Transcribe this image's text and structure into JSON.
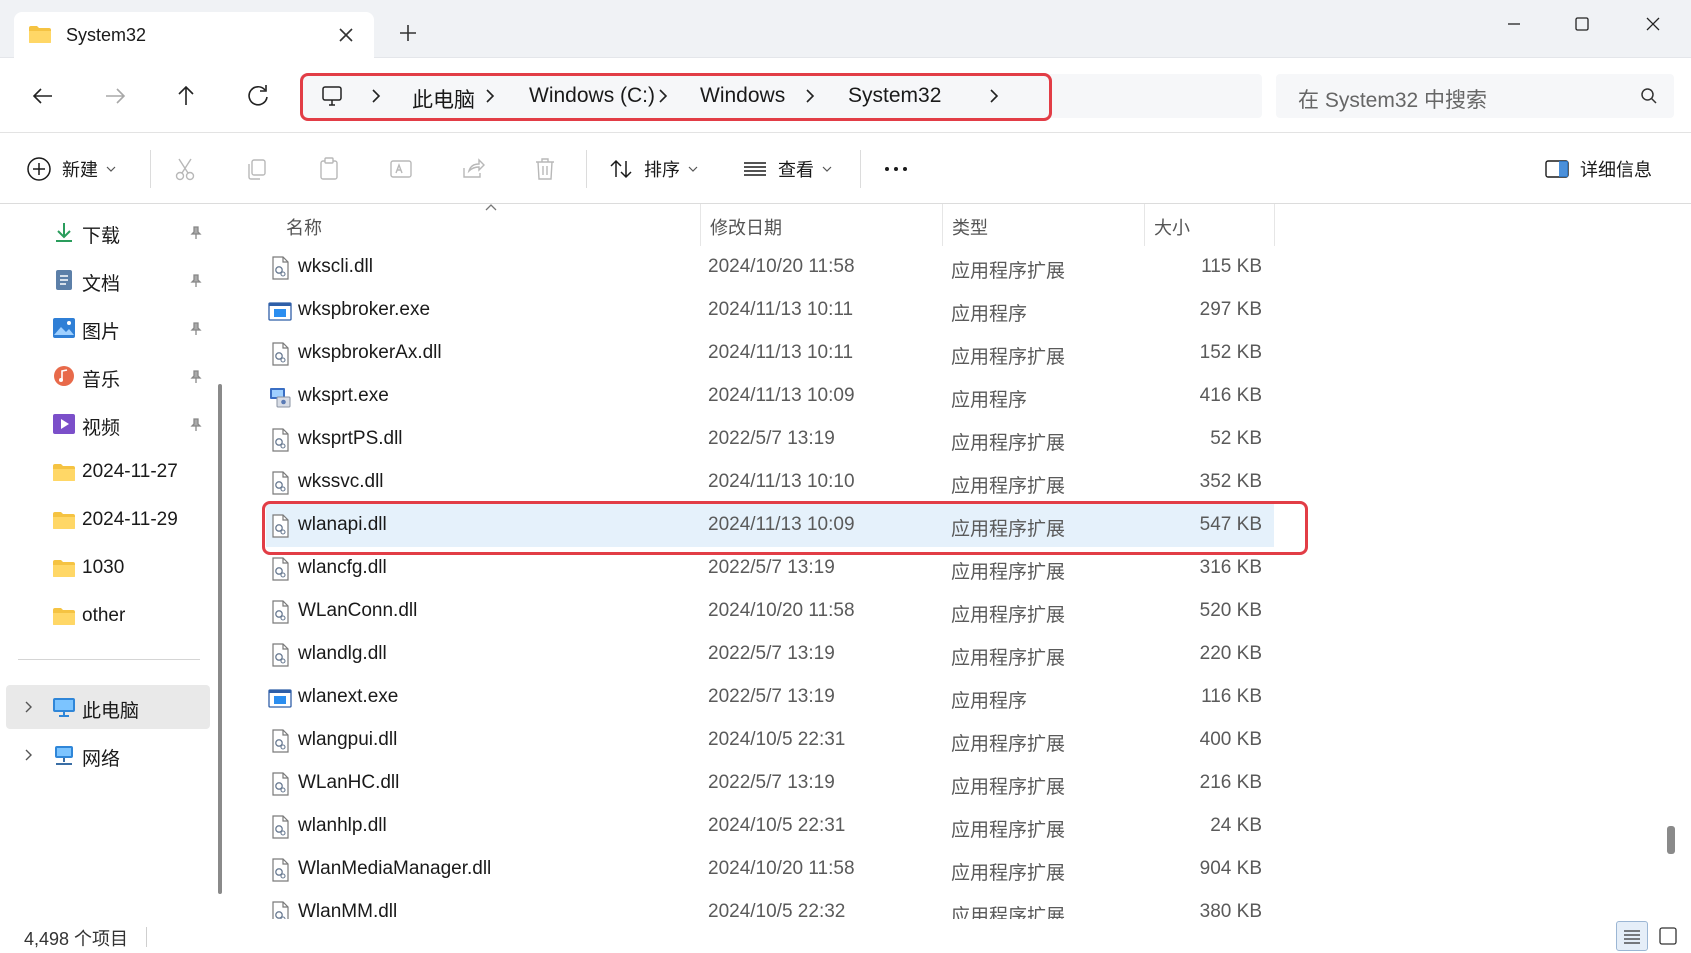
{
  "tab": {
    "title": "System32"
  },
  "breadcrumb": [
    "此电脑",
    "Windows (C:)",
    "Windows",
    "System32"
  ],
  "search": {
    "placeholder": "在 System32 中搜索"
  },
  "toolbar": {
    "new_label": "新建",
    "sort_label": "排序",
    "view_label": "查看",
    "details_label": "详细信息"
  },
  "sidebar": {
    "quick": [
      {
        "label": "下载",
        "icon": "download-icon"
      },
      {
        "label": "文档",
        "icon": "document-icon"
      },
      {
        "label": "图片",
        "icon": "pictures-icon"
      },
      {
        "label": "音乐",
        "icon": "music-icon"
      },
      {
        "label": "视频",
        "icon": "video-icon"
      },
      {
        "label": "2024-11-27",
        "icon": "folder-icon"
      },
      {
        "label": "2024-11-29",
        "icon": "folder-icon"
      },
      {
        "label": "1030",
        "icon": "folder-icon"
      },
      {
        "label": "other",
        "icon": "folder-icon"
      }
    ],
    "this_pc": "此电脑",
    "network": "网络"
  },
  "columns": {
    "name": "名称",
    "date": "修改日期",
    "type": "类型",
    "size": "大小"
  },
  "files": [
    {
      "name": "wkscli.dll",
      "date": "2024/10/20 11:58",
      "type": "应用程序扩展",
      "size": "115 KB",
      "kind": "dll"
    },
    {
      "name": "wkspbroker.exe",
      "date": "2024/11/13 10:11",
      "type": "应用程序",
      "size": "297 KB",
      "kind": "exe"
    },
    {
      "name": "wkspbrokerAx.dll",
      "date": "2024/11/13 10:11",
      "type": "应用程序扩展",
      "size": "152 KB",
      "kind": "dll"
    },
    {
      "name": "wksprt.exe",
      "date": "2024/11/13 10:09",
      "type": "应用程序",
      "size": "416 KB",
      "kind": "exe2"
    },
    {
      "name": "wksprtPS.dll",
      "date": "2022/5/7 13:19",
      "type": "应用程序扩展",
      "size": "52 KB",
      "kind": "dll"
    },
    {
      "name": "wkssvc.dll",
      "date": "2024/11/13 10:10",
      "type": "应用程序扩展",
      "size": "352 KB",
      "kind": "dll"
    },
    {
      "name": "wlanapi.dll",
      "date": "2024/11/13 10:09",
      "type": "应用程序扩展",
      "size": "547 KB",
      "kind": "dll"
    },
    {
      "name": "wlancfg.dll",
      "date": "2022/5/7 13:19",
      "type": "应用程序扩展",
      "size": "316 KB",
      "kind": "dll"
    },
    {
      "name": "WLanConn.dll",
      "date": "2024/10/20 11:58",
      "type": "应用程序扩展",
      "size": "520 KB",
      "kind": "dll"
    },
    {
      "name": "wlandlg.dll",
      "date": "2022/5/7 13:19",
      "type": "应用程序扩展",
      "size": "220 KB",
      "kind": "dll"
    },
    {
      "name": "wlanext.exe",
      "date": "2022/5/7 13:19",
      "type": "应用程序",
      "size": "116 KB",
      "kind": "exe"
    },
    {
      "name": "wlangpui.dll",
      "date": "2024/10/5 22:31",
      "type": "应用程序扩展",
      "size": "400 KB",
      "kind": "dll"
    },
    {
      "name": "WLanHC.dll",
      "date": "2022/5/7 13:19",
      "type": "应用程序扩展",
      "size": "216 KB",
      "kind": "dll"
    },
    {
      "name": "wlanhlp.dll",
      "date": "2024/10/5 22:31",
      "type": "应用程序扩展",
      "size": "24 KB",
      "kind": "dll"
    },
    {
      "name": "WlanMediaManager.dll",
      "date": "2024/10/20 11:58",
      "type": "应用程序扩展",
      "size": "904 KB",
      "kind": "dll"
    },
    {
      "name": "WlanMM.dll",
      "date": "2024/10/5 22:32",
      "type": "应用程序扩展",
      "size": "380 KB",
      "kind": "dll"
    }
  ],
  "selected_file": "wlanapi.dll",
  "status": {
    "count": "4,498 个项目"
  },
  "colors": {
    "highlight": "#e23d46",
    "selection": "#e5f1fb",
    "folder": "#f5c342",
    "accent": "#2b7cd3"
  }
}
